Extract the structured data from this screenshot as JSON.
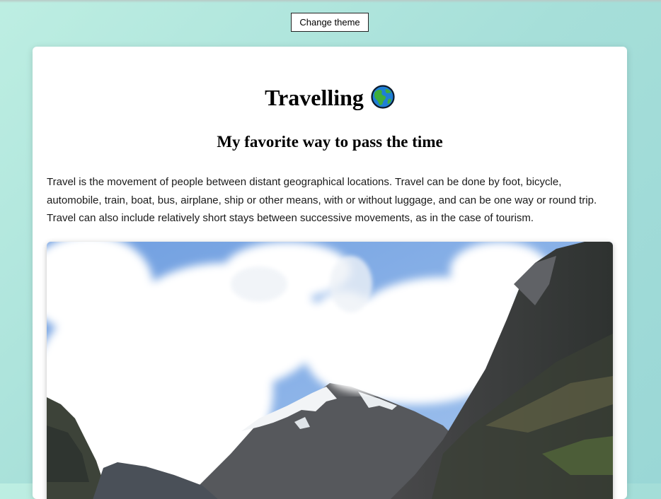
{
  "header": {
    "theme_button_label": "Change theme"
  },
  "article": {
    "title": "Travelling",
    "title_icon": "globe-icon",
    "subtitle": "My favorite way to pass the time",
    "paragraph": "Travel is the movement of people between distant geographical locations. Travel can be done by foot, bicycle, automobile, train, boat, bus, airplane, ship or other means, with or without luggage, and can be one way or round trip. Travel can also include relatively short stays between successive movements, as in the case of tourism.",
    "image_icon": "mountain-landscape-photo"
  },
  "colors": {
    "background_start": "#bdeee2",
    "background_end": "#9ad7d6",
    "card": "#ffffff"
  }
}
